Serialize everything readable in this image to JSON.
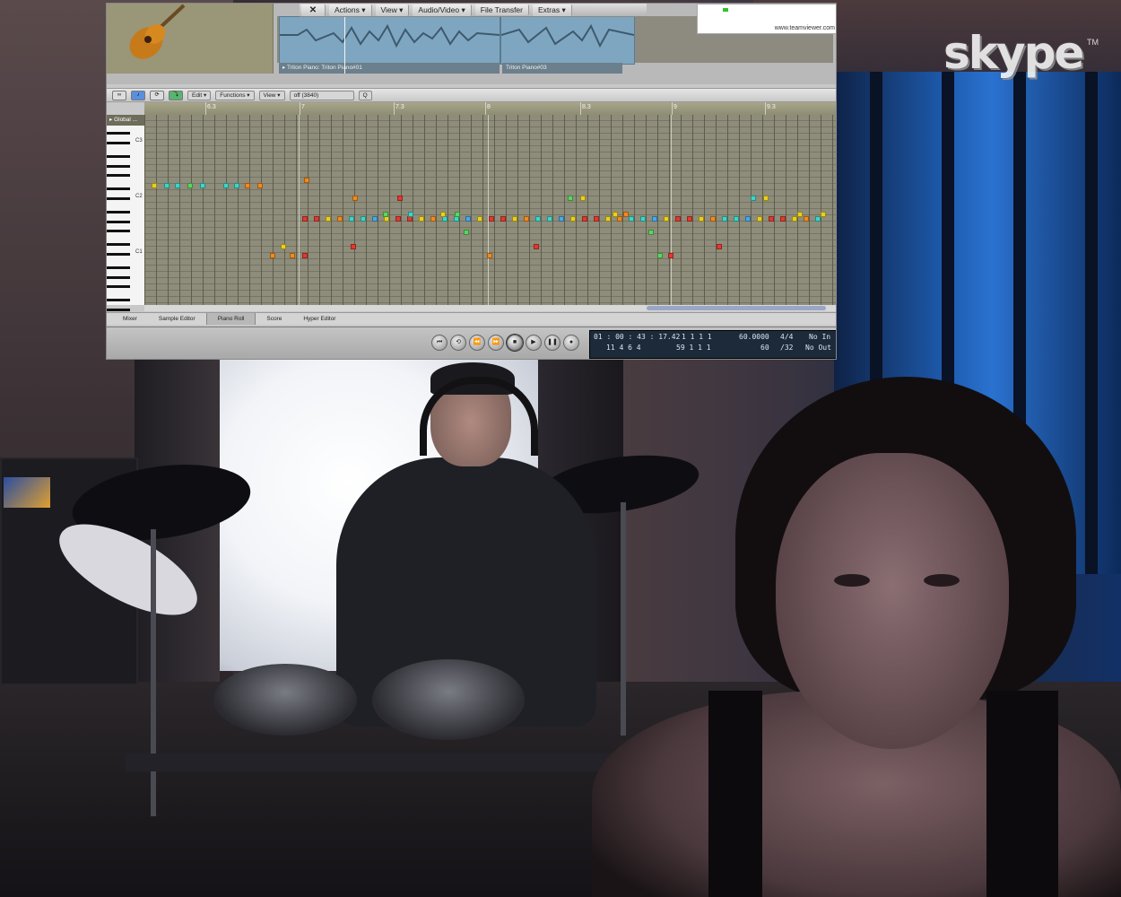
{
  "skype": {
    "logo_text": "skype",
    "trademark": "TM"
  },
  "logic": {
    "arrange_toolbar": {
      "close": "✕",
      "buttons": [
        "Actions ▾",
        "View ▾",
        "Audio/Video ▾",
        "File Transfer",
        "Extras ▾"
      ]
    },
    "regions": [
      "▸ Triton Piano: Triton Piano#01",
      "Triton Piano#03"
    ],
    "teamviewer_url": "www.teamviewer.com",
    "editor_bar": {
      "edit": "Edit ▾",
      "functions": "Functions ▾",
      "view": "View ▾",
      "quantize": "off (3840)",
      "q_button": "Q"
    },
    "ruler": [
      "6.3",
      "7",
      "7.3",
      "8",
      "8.3",
      "9",
      "9.3"
    ],
    "global_label": "▸ Global ...",
    "octave_labels": [
      "C3",
      "C2",
      "C1"
    ],
    "tabs": [
      "Mixer",
      "Sample Editor",
      "Piano Roll",
      "Score",
      "Hyper Editor"
    ],
    "active_tab": "Piano Roll",
    "transport_buttons": [
      "⏮",
      "⟲",
      "⏪",
      "⏩",
      "■",
      "▶",
      "❚❚",
      "●"
    ],
    "lcd": {
      "smpte": "01 : 00 : 43 : 17.42",
      "smpte_sub": "11   4   6   4",
      "bars": "1   1   1   1",
      "bars2": "59   1   1   1",
      "tempo": "60.0000",
      "tempo_sub": "60",
      "sig": "4/4",
      "div": "/32",
      "in": "No In",
      "out": "No Out"
    },
    "note_colors": {
      "yellow": "#e8d020",
      "cyan": "#40d4c8",
      "red": "#e03a30",
      "orange": "#f08a20",
      "green": "#5ed460",
      "blue": "#4aa8e8"
    }
  }
}
